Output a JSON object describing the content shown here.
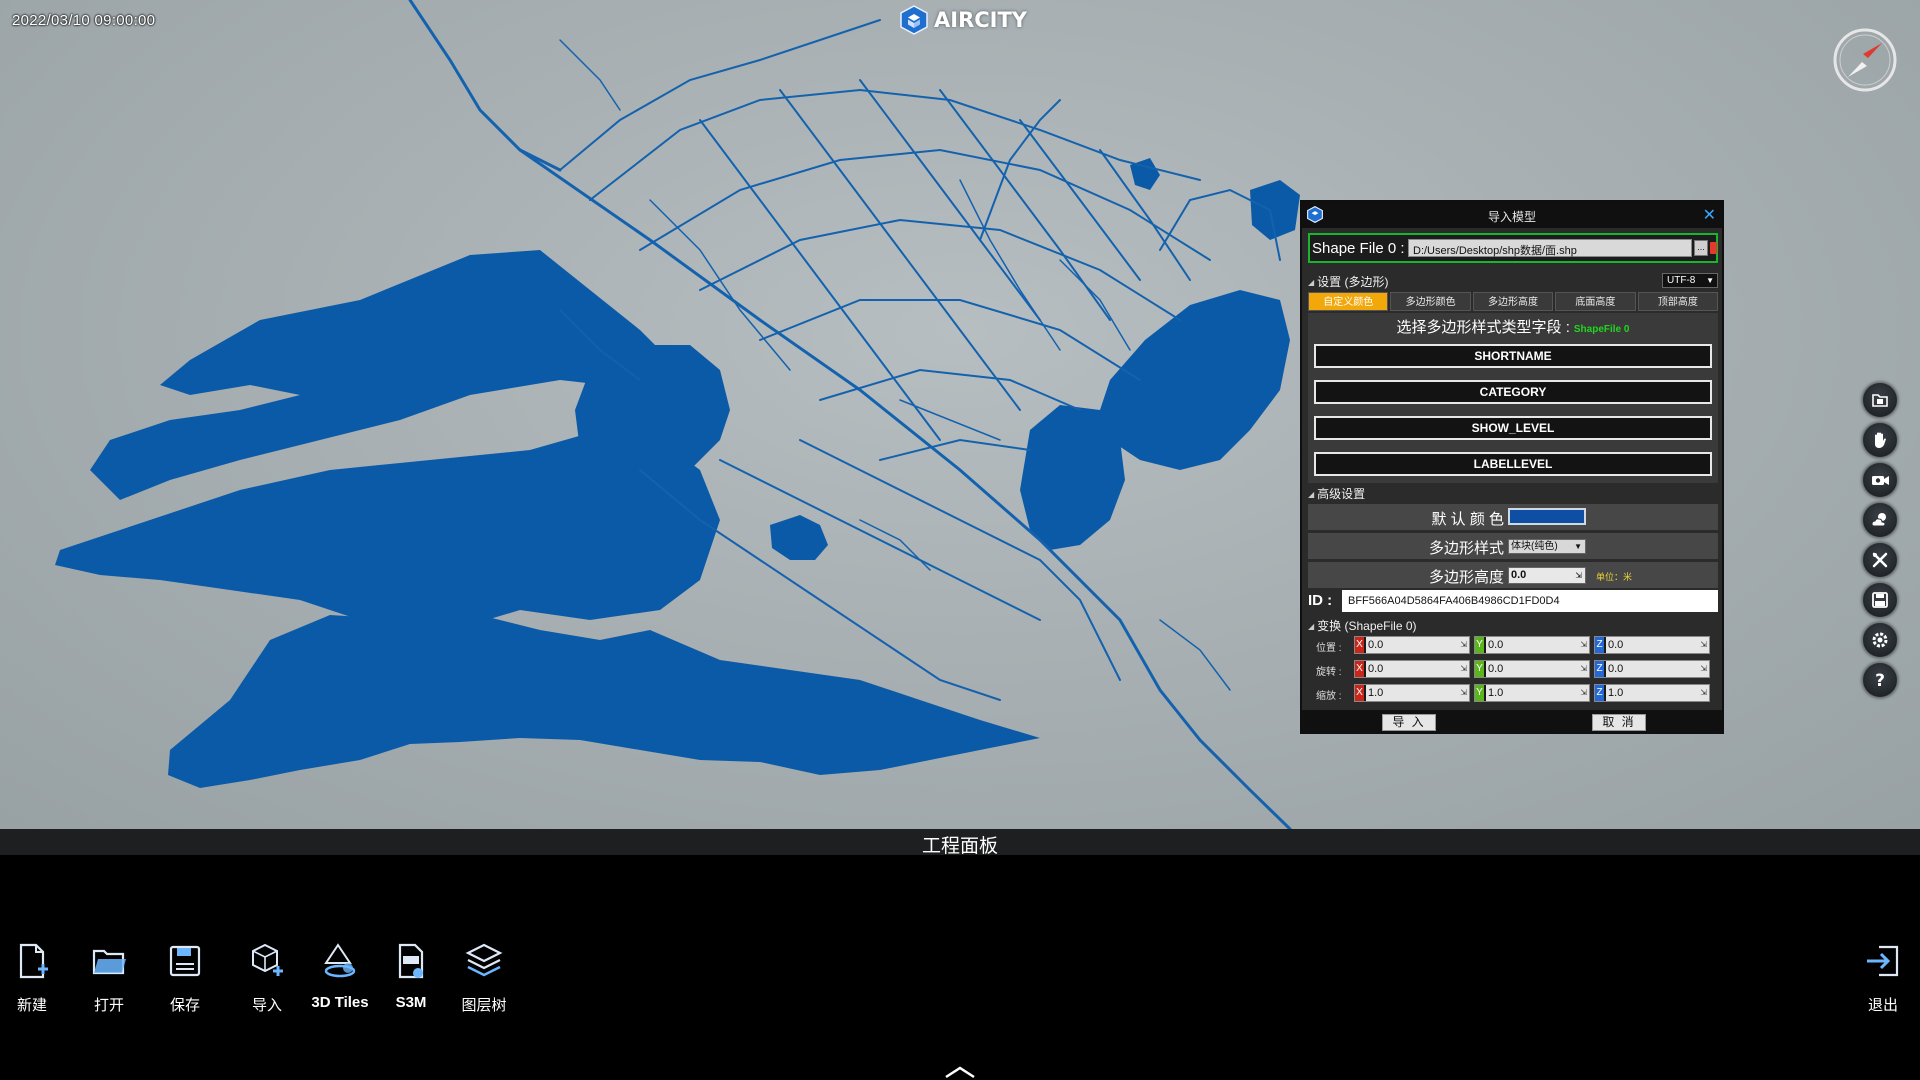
{
  "datetime": "2022/03/10   09:00:00",
  "brand": {
    "name": "AIRCITY"
  },
  "right_toolbar": {
    "items": [
      {
        "icon": "folder-icon"
      },
      {
        "icon": "hand-icon"
      },
      {
        "icon": "camera-icon"
      },
      {
        "icon": "weather-icon"
      },
      {
        "icon": "tools-icon"
      },
      {
        "icon": "save-icon"
      },
      {
        "icon": "settings-icon"
      },
      {
        "icon": "help-icon"
      }
    ]
  },
  "dialog": {
    "title": "导入模型",
    "file": {
      "label": "Shape File 0 :",
      "path": "D:/Users/Desktop/shp数据/面.shp",
      "browse": "..."
    },
    "settings": {
      "title": "设置 (多边形)",
      "encoding": "UTF-8"
    },
    "tabs": [
      "自定义颜色",
      "多边形颜色",
      "多边形高度",
      "底面高度",
      "顶部高度"
    ],
    "active_tab": "自定义颜色",
    "style_prompt": "选择多边形样式类型字段 :",
    "style_source": "ShapeFile 0",
    "fields": [
      "SHORTNAME",
      "CATEGORY",
      "SHOW_LEVEL",
      "LABELLEVEL"
    ],
    "advanced": {
      "title": "高级设置",
      "default_color_label": "默 认 颜 色",
      "default_color": "#0f4fa3",
      "polygon_style_label": "多边形样式",
      "polygon_style": "体块(纯色)",
      "polygon_height_label": "多边形高度",
      "polygon_height": "0.0",
      "unit_note": "单位：米"
    },
    "id": {
      "label": "ID :",
      "value": "BFF566A04D5864FA406B4986CD1FD0D4"
    },
    "transform": {
      "title": "变换 (ShapeFile 0)",
      "rows": [
        {
          "label": "位置 :",
          "x": "0.0",
          "y": "0.0",
          "z": "0.0"
        },
        {
          "label": "旋转 :",
          "x": "0.0",
          "y": "0.0",
          "z": "0.0"
        },
        {
          "label": "缩放 :",
          "x": "1.0",
          "y": "1.0",
          "z": "1.0"
        }
      ]
    },
    "buttons": {
      "import": "导 入",
      "cancel": "取 消"
    }
  },
  "bottom_panel": {
    "title": "工程面板",
    "tools": [
      {
        "label": "新建",
        "icon": "new-file-icon"
      },
      {
        "label": "打开",
        "icon": "open-folder-icon"
      },
      {
        "label": "保存",
        "icon": "save-disk-icon"
      },
      {
        "label": "导入",
        "icon": "import-model-icon"
      },
      {
        "label": "3D Tiles",
        "icon": "3d-tiles-icon"
      },
      {
        "label": "S3M",
        "icon": "s3m-icon"
      },
      {
        "label": "图层树",
        "icon": "layer-tree-icon"
      }
    ],
    "exit": {
      "label": "退出",
      "icon": "exit-icon"
    }
  },
  "colors": {
    "water": "#0b5aa8",
    "road": "#1462ad",
    "accent": "#f2a80b",
    "highlight": "#17b62c"
  }
}
